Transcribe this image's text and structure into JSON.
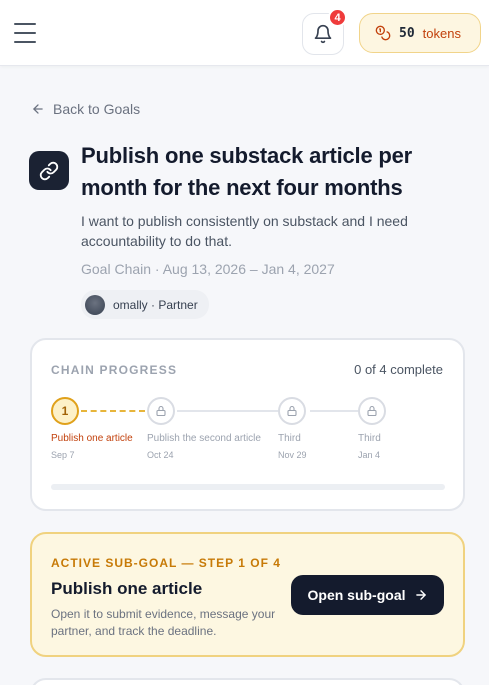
{
  "header": {
    "notification_count": "4",
    "tokens_count": "50",
    "tokens_label": "tokens"
  },
  "nav": {
    "back_label": "Back to Goals"
  },
  "goal": {
    "title": "Publish one substack article per month for the next four months",
    "description": "I want to publish consistently on substack and I need accountability to do that.",
    "meta": "Goal Chain · Aug 13, 2026 – Jan 4, 2027",
    "partner": "omally · Partner"
  },
  "chain_progress": {
    "title": "CHAIN PROGRESS",
    "status": "0 of 4 complete",
    "progress_fraction": 0.0,
    "steps": [
      {
        "marker": "1",
        "label": "Publish one article",
        "date": "Sep 7",
        "state": "active"
      },
      {
        "label": "Publish the second article",
        "date": "Oct 24",
        "state": "locked"
      },
      {
        "label": "Third",
        "date": "Nov 29",
        "state": "locked"
      },
      {
        "label": "Third",
        "date": "Jan 4",
        "state": "locked"
      }
    ]
  },
  "active_subgoal": {
    "eyebrow": "ACTIVE SUB-GOAL — STEP 1 OF 4",
    "title": "Publish one article",
    "description": "Open it to submit evidence, message your partner, and track the deadline.",
    "button_label": "Open sub-goal"
  },
  "colors": {
    "accent_amber": "#e7b53b",
    "brand_dark": "#141b2d",
    "badge_red": "#ef3b3b"
  }
}
